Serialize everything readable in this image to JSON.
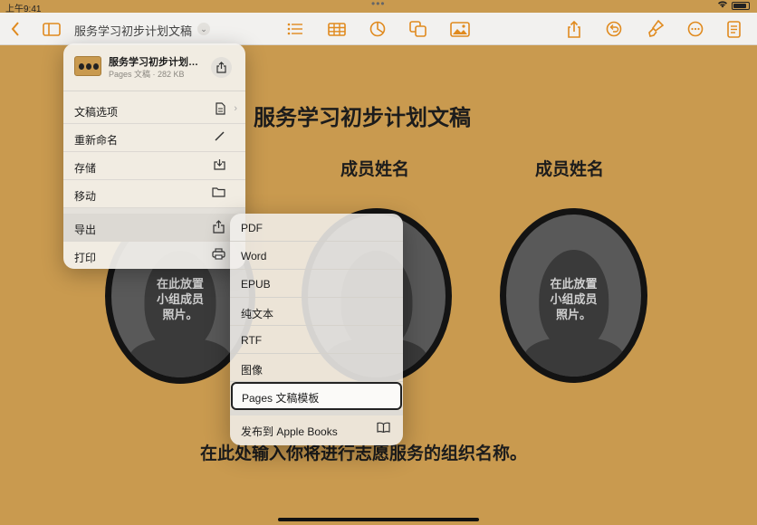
{
  "status": {
    "time": "上午9:41",
    "dots": "•••",
    "battery_label": "100%"
  },
  "toolbar": {
    "doc_title": "服务学习初步计划文稿",
    "title_chevron": "⌄",
    "icons": [
      "back-chevron-icon",
      "sidebar-icon",
      "list-icon",
      "table-icon",
      "chart-icon",
      "shape-icon",
      "media-icon",
      "share-icon",
      "undo-icon",
      "format-brush-icon",
      "more-icon",
      "document-icon"
    ]
  },
  "document": {
    "heading": "服务学习初步计划文稿",
    "member_name_1": "成员姓名",
    "member_name_2": "成员姓名",
    "photo_placeholder": "在此放置\n小组成员\n照片。",
    "footer_text": "在此处输入你将进行志愿服务的组织名称。"
  },
  "menu": {
    "file_name": "服务学习初步计划文稿",
    "file_meta": "Pages 文稿 · 282 KB",
    "items": [
      {
        "label": "文稿选项"
      },
      {
        "label": "重新命名"
      },
      {
        "label": "存储"
      },
      {
        "label": "移动"
      },
      {
        "label": "导出"
      },
      {
        "label": "打印"
      }
    ]
  },
  "export_menu": {
    "items": [
      {
        "label": "PDF"
      },
      {
        "label": "Word"
      },
      {
        "label": "EPUB"
      },
      {
        "label": "纯文本"
      },
      {
        "label": "RTF"
      },
      {
        "label": "图像"
      },
      {
        "label": "Pages 文稿模板"
      },
      {
        "label": "发布到 Apple Books"
      }
    ],
    "selected": "Pages 文稿模板"
  },
  "colors": {
    "accent": "#e08a1e",
    "canvas": "#c99a4f"
  }
}
